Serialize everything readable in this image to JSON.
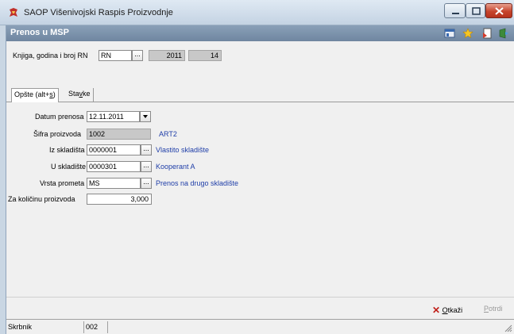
{
  "window": {
    "app_title": "SAOP  Višenivojski Raspis Proizvodnje"
  },
  "form": {
    "title": "Prenos u MSP",
    "toolbar_icons": [
      "layout-icon",
      "star-icon",
      "document-icon",
      "exit-icon"
    ]
  },
  "header_fields": {
    "label": "Knjiga, godina i broj RN",
    "book": "RN",
    "year": "2011",
    "number": "14"
  },
  "tabs": [
    {
      "label_pre": "Opšte (alt+",
      "label_hot": "s",
      "label_post": ")",
      "active": true
    },
    {
      "label_pre": "Sta",
      "label_hot": "v",
      "label_post": "ke",
      "active": false
    }
  ],
  "fields": {
    "datum_label": "Datum prenosa",
    "datum_value": "12.11.2011",
    "sifra_label": "Šifra proizvoda",
    "sifra_value": "1002",
    "sifra_desc": "ART2",
    "iz_label": "Iz skladišta",
    "iz_value": "0000001",
    "iz_desc": "Vlastito skladište",
    "u_label": "U skladište",
    "u_value": "0000301",
    "u_desc": "Kooperant A",
    "vrsta_label": "Vrsta prometa",
    "vrsta_value": "MS",
    "vrsta_desc": "Prenos na drugo skladište",
    "kol_label": "Za količinu proizvoda",
    "kol_value": "3,000"
  },
  "actions": {
    "cancel_hot": "O",
    "cancel_rest": "tkaži",
    "confirm_hot": "P",
    "confirm_rest": "otrdi"
  },
  "status": {
    "label": "Skrbnik",
    "value": "002"
  },
  "colors": {
    "header_bar": "#7890aa",
    "link_text": "#1f3ea8",
    "readonly_field": "#c8c8c8"
  }
}
